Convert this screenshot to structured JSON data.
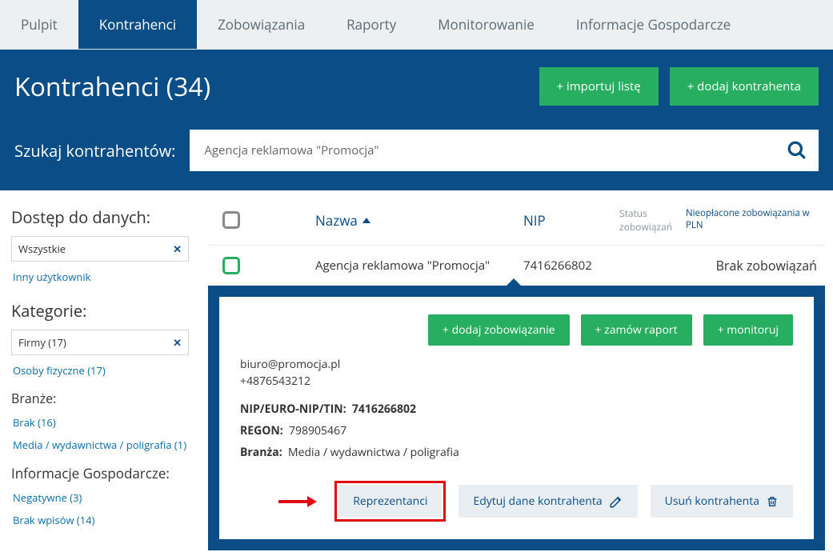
{
  "tabs": {
    "pulpit": "Pulpit",
    "kontrahenci": "Kontrahenci",
    "zobowiazania": "Zobowiązania",
    "raporty": "Raporty",
    "monitorowanie": "Monitorowanie",
    "informacje": "Informacje Gospodarcze"
  },
  "title": "Kontrahenci (34)",
  "header_buttons": {
    "import": "+ importuj listę",
    "add": "+ dodaj kontrahenta"
  },
  "search": {
    "label": "Szukaj kontrahentów:",
    "value": "Agencja reklamowa \"Promocja\""
  },
  "sidebar": {
    "h_access": "Dostęp do danych:",
    "access_all": "Wszystkie",
    "access_other": "Inny użytkownik",
    "h_categories": "Kategorie:",
    "cat_firms": "Firmy (17)",
    "cat_persons": "Osoby fizyczne (17)",
    "h_branches": "Branże:",
    "brak": "Brak (16)",
    "media": "Media / wydawnictwa / poligrafia (1)",
    "h_info": "Informacje Gospodarcze:",
    "neg": "Negatywne (3)",
    "brak_wpisow": "Brak wpisów (14)"
  },
  "thead": {
    "name": "Nazwa",
    "nip": "NIP",
    "status": "Status zobowiązań",
    "unpaid": "Nieopłacone zobowiązania w PLN"
  },
  "row": {
    "name": "Agencja reklamowa \"Promocja\"",
    "nip": "7416266802",
    "unpaid": "Brak zobowiązań"
  },
  "detail": {
    "btns": {
      "add": "+ dodaj zobowiązanie",
      "order": "+ zamów raport",
      "monitor": "+ monitoruj"
    },
    "email": "biuro@promocja.pl",
    "phone": "+4876543212",
    "nip_lbl": "NIP/EURO-NIP/TIN:",
    "nip_val": "7416266802",
    "regon_lbl": "REGON:",
    "regon_val": "798905467",
    "branza_lbl": "Branża:",
    "branza_val": "Media / wydawnictwa / poligrafia",
    "foot": {
      "repr": "Reprezentanci",
      "edit": "Edytuj dane kontrahenta",
      "del": "Usuń kontrahenta"
    }
  }
}
